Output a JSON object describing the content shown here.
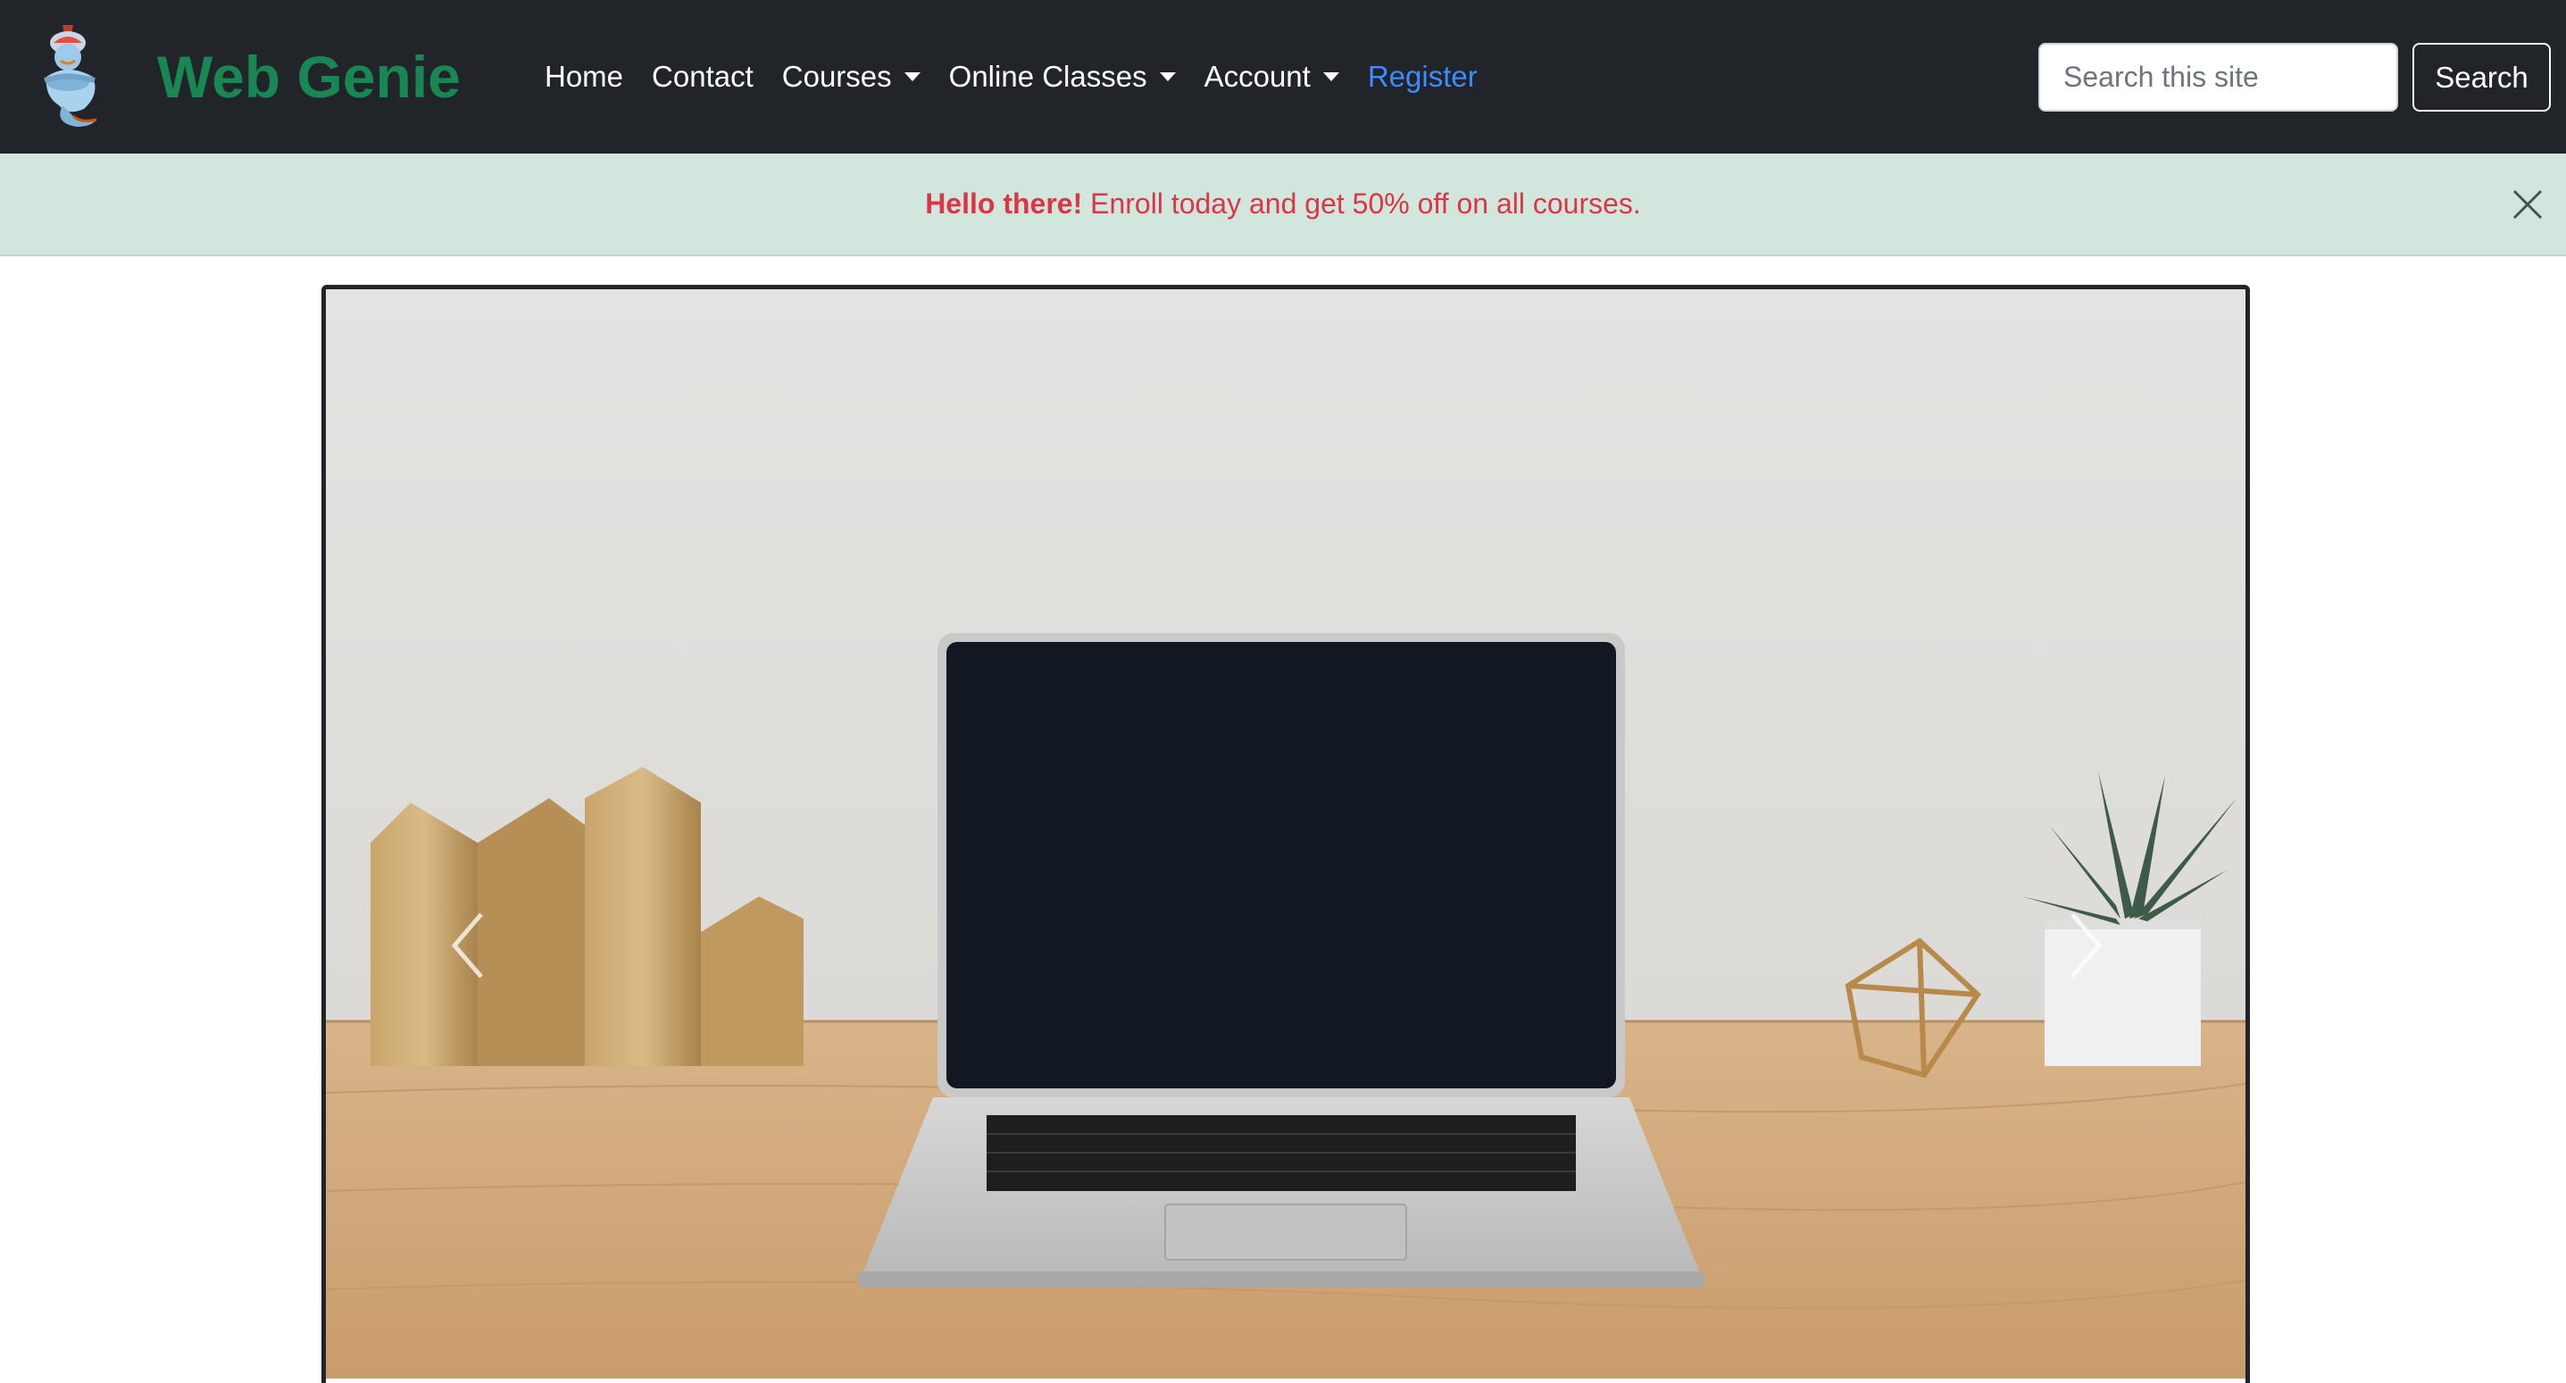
{
  "navbar": {
    "brand": "Web Genie",
    "logo_icon": "genie-icon",
    "links": [
      {
        "label": "Home",
        "dropdown": false
      },
      {
        "label": "Contact",
        "dropdown": false
      },
      {
        "label": "Courses",
        "dropdown": true
      },
      {
        "label": "Online Classes",
        "dropdown": true
      },
      {
        "label": "Account",
        "dropdown": true
      },
      {
        "label": "Register",
        "dropdown": false
      }
    ],
    "search": {
      "placeholder": "Search this site",
      "button_label": "Search"
    }
  },
  "alert": {
    "bold": "Hello there!",
    "message": " Enroll today and get 50% off on all courses.",
    "close_icon": "close-icon"
  },
  "carousel": {
    "image_icon": "laptop-desk-photo",
    "prev_icon": "chevron-left-icon",
    "next_icon": "chevron-right-icon"
  },
  "colors": {
    "navbar_bg": "#212529",
    "brand": "#198754",
    "register_link": "#3d8bfd",
    "alert_bg": "#d1e7dd",
    "alert_text": "#dc3545"
  }
}
